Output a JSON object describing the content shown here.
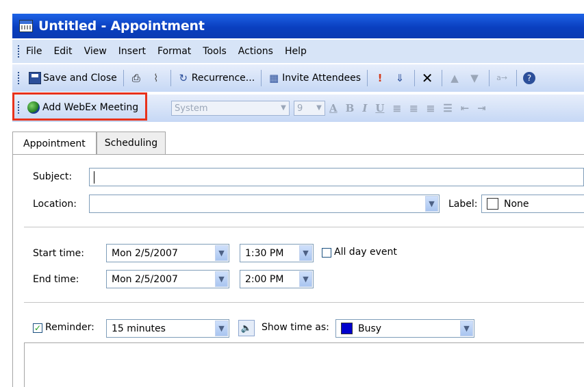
{
  "window": {
    "title": "Untitled - Appointment"
  },
  "menu": [
    "File",
    "Edit",
    "View",
    "Insert",
    "Format",
    "Tools",
    "Actions",
    "Help"
  ],
  "toolbar": {
    "save_close": "Save and Close",
    "recurrence": "Recurrence...",
    "invite": "Invite Attendees"
  },
  "webex": {
    "label": "Add WebEx Meeting"
  },
  "format": {
    "font": "System",
    "size": "9"
  },
  "tabs": [
    "Appointment",
    "Scheduling"
  ],
  "form": {
    "subject_label": "Subject:",
    "subject_value": "",
    "location_label": "Location:",
    "location_value": "",
    "label_label": "Label:",
    "label_value": "None",
    "start_label": "Start time:",
    "start_date": "Mon 2/5/2007",
    "start_time": "1:30 PM",
    "all_day_label": "All day event",
    "all_day_checked": false,
    "end_label": "End time:",
    "end_date": "Mon 2/5/2007",
    "end_time": "2:00 PM",
    "reminder_label": "Reminder:",
    "reminder_checked": true,
    "reminder_value": "15 minutes",
    "showtime_label": "Show time as:",
    "showtime_value": "Busy",
    "busy_color": "#0000cc"
  },
  "colors": {
    "title_bar": "#0a3fbf",
    "highlight": "#e8321b",
    "toolbar": "#c6d8f5"
  }
}
